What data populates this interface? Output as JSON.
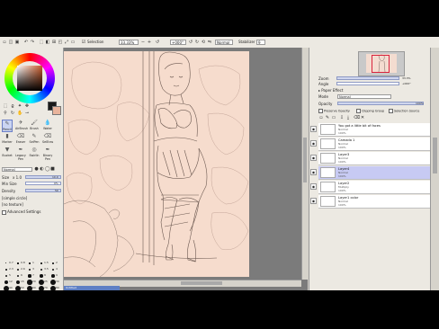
{
  "toolbar": {
    "selection_label": "Selection",
    "zoom_value": "33.33%",
    "rotation_value": "+000°",
    "blend_mode": "Normal",
    "stabilizer_label": "Stabilizer",
    "stabilizer_value": "9"
  },
  "left_panel": {
    "tools": [
      {
        "label": "Pencil",
        "icon": "pencil-icon"
      },
      {
        "label": "AirBrush",
        "icon": "airbrush-icon"
      },
      {
        "label": "Brush",
        "icon": "brush-icon"
      },
      {
        "label": "Water",
        "icon": "water-icon"
      },
      {
        "label": "Marker",
        "icon": "marker-icon"
      },
      {
        "label": "Eraser",
        "icon": "eraser-icon"
      },
      {
        "label": "SelPen",
        "icon": "selpen-icon"
      },
      {
        "label": "SelEras",
        "icon": "seleras-icon"
      },
      {
        "label": "Bucket",
        "icon": "bucket-icon"
      },
      {
        "label": "Legacy Pen",
        "icon": "legacy-pen-icon"
      },
      {
        "label": "SwirlIn",
        "icon": "swirl-icon"
      },
      {
        "label": "Binary Pen",
        "icon": "binary-pen-icon"
      }
    ],
    "blend_mode": "Normal",
    "size_label": "Size",
    "size_multiplier": "x 1.0",
    "size_value": "10.0",
    "min_size_label": "Min Size",
    "min_size_value": "0%",
    "density_label": "Density",
    "density_value": "50",
    "simple_circle": "[simple circle]",
    "no_texture": "[no texture]",
    "advanced_settings": "Advanced Settings",
    "brush_sizes": [
      [
        "0.7",
        "0.8",
        "1",
        "1.5",
        "2"
      ],
      [
        "2.3",
        "2.6",
        "3",
        "3.5",
        "4"
      ],
      [
        "5",
        "6",
        "7",
        "8",
        "9"
      ],
      [
        "12",
        "15",
        "20",
        "25",
        "30"
      ],
      [
        "40",
        "50",
        "60",
        "70",
        "80"
      ]
    ]
  },
  "canvas": {
    "status_text": "Untitled"
  },
  "right_panel": {
    "zoom_label": "Zoom",
    "zoom_value": "33.3%",
    "angle_label": "Angle",
    "angle_value": "+000°",
    "paper_effect_label": "Paper Effect",
    "mode_label": "Mode",
    "mode_value": "Normal",
    "opacity_label": "Opacity",
    "opacity_value": "100%",
    "preserve_opacity": "Preserve Opacity",
    "clipping_group": "Clipping Group",
    "selection_source": "Selection Source",
    "layers": [
      {
        "name": "You got a little bit of faces",
        "mode": "Normal",
        "opacity": "100%",
        "visible": true,
        "selected": false
      },
      {
        "name": "Camada 1",
        "mode": "Normal",
        "opacity": "100%",
        "visible": true,
        "selected": false
      },
      {
        "name": "Layer3",
        "mode": "Normal",
        "opacity": "100%",
        "visible": true,
        "selected": false
      },
      {
        "name": "Layer4",
        "mode": "Normal",
        "opacity": "100%",
        "visible": true,
        "selected": true
      },
      {
        "name": "Layer2",
        "mode": "Multiply",
        "opacity": "100%",
        "visible": true,
        "selected": false
      },
      {
        "name": "Layer1 color",
        "mode": "Normal",
        "opacity": "100%",
        "visible": true,
        "selected": false
      }
    ]
  },
  "colors": {
    "primary_color": "#1a1a1a",
    "secondary_color": "#e9b49c",
    "canvas_bg": "#f6dccd",
    "selected_layer": "#c7caf3"
  }
}
